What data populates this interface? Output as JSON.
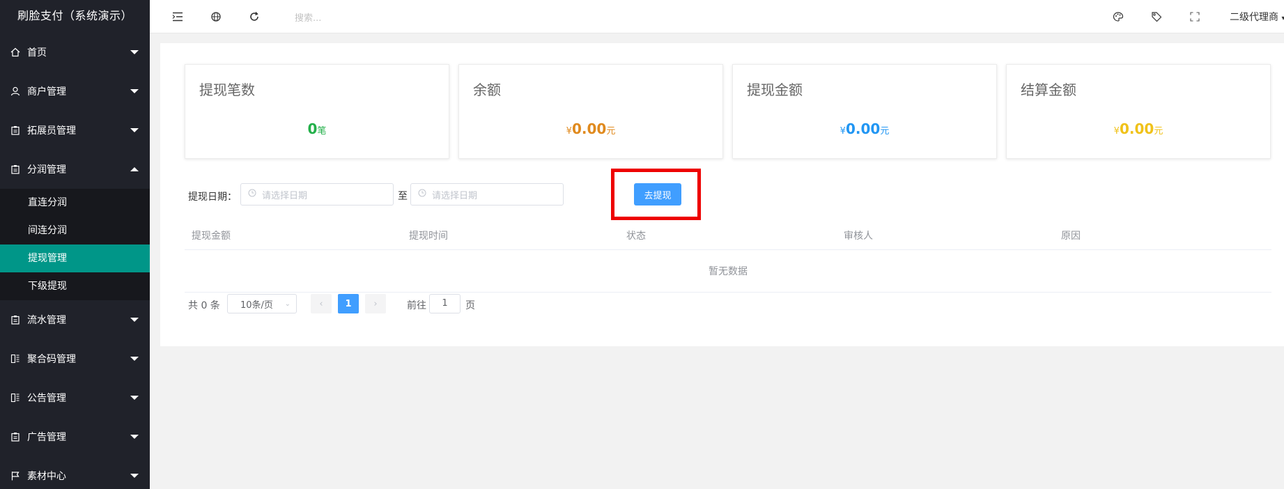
{
  "app": {
    "title": "刷脸支付（系统演示）"
  },
  "sidebar": {
    "items": [
      {
        "label": "首页",
        "icon": "home-icon",
        "expanded": false
      },
      {
        "label": "商户管理",
        "icon": "user-icon",
        "expanded": false
      },
      {
        "label": "拓展员管理",
        "icon": "clipboard-icon",
        "expanded": false
      },
      {
        "label": "分润管理",
        "icon": "clipboard-icon",
        "expanded": true,
        "children": [
          "直连分润",
          "间连分润",
          "提现管理",
          "下级提现"
        ],
        "active_child": "提现管理"
      },
      {
        "label": "流水管理",
        "icon": "clipboard-icon",
        "expanded": false
      },
      {
        "label": "聚合码管理",
        "icon": "qrcode-icon",
        "expanded": false
      },
      {
        "label": "公告管理",
        "icon": "qrcode-icon",
        "expanded": false
      },
      {
        "label": "广告管理",
        "icon": "clipboard-icon",
        "expanded": false
      },
      {
        "label": "素材中心",
        "icon": "flag-icon",
        "expanded": false
      }
    ]
  },
  "header": {
    "search_placeholder": "搜索...",
    "user_label": "二级代理商",
    "icons": [
      "menu-toggle-icon",
      "globe-icon",
      "refresh-icon",
      "palette-icon",
      "tag-icon",
      "fullscreen-icon"
    ]
  },
  "stats": [
    {
      "title": "提现笔数",
      "currency": "",
      "value": "0",
      "unit": "笔",
      "color": "#23b04a"
    },
    {
      "title": "余额",
      "currency": "¥",
      "value": "0.00",
      "unit": "元",
      "color": "#e08a1e"
    },
    {
      "title": "提现金额",
      "currency": "¥",
      "value": "0.00",
      "unit": "元",
      "color": "#2196f3"
    },
    {
      "title": "结算金额",
      "currency": "¥",
      "value": "0.00",
      "unit": "元",
      "color": "#f0c21a"
    }
  ],
  "filter": {
    "date_label": "提现日期：",
    "start_placeholder": "请选择日期",
    "end_placeholder": "请选择日期",
    "separator": "至",
    "withdraw_button": "去提现"
  },
  "table": {
    "columns": [
      "提现金额",
      "提现时间",
      "状态",
      "审核人",
      "原因"
    ],
    "rows": [],
    "empty_text": "暂无数据"
  },
  "pagination": {
    "total_text": "共 0 条",
    "page_size": "10条/页",
    "current_page": "1",
    "goto_label": "前往",
    "goto_value": "1",
    "page_suffix": "页"
  },
  "colors": {
    "sidebar_bg": "#20222a",
    "active_item": "#009688",
    "primary": "#409eff",
    "highlight": "#ee0000"
  }
}
